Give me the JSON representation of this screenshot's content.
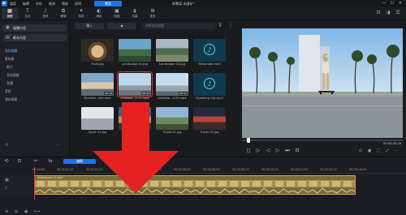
{
  "app": {
    "logo_glyph": "▶",
    "menus": [
      "檔案",
      "編輯",
      "外掛",
      "檢視",
      "播放",
      "說明"
    ],
    "project_button": "專案",
    "project_name": "新專案.未儲存*",
    "window_controls": [
      "—",
      "☐",
      "✕"
    ]
  },
  "toolbar": {
    "tools": [
      {
        "icon": "▦",
        "label": "媒體"
      },
      {
        "icon": "T",
        "label": "文字"
      },
      {
        "icon": "♪",
        "label": "音訊"
      },
      {
        "icon": "⧉",
        "label": "轉場"
      },
      {
        "icon": "✦",
        "label": "特效"
      },
      {
        "icon": "◐",
        "label": "調色"
      },
      {
        "icon": "▣",
        "label": "貼圖"
      },
      {
        "icon": "⧗",
        "label": "字幕"
      },
      {
        "icon": "⊞",
        "label": "更多"
      }
    ],
    "right_icons": [
      "⊡",
      "◑",
      "☰"
    ]
  },
  "sidebar": {
    "tabs": [
      "媒體內容",
      "範本內容"
    ],
    "items": [
      {
        "label": "我的媒體",
        "selected": true
      },
      {
        "label": "素材庫",
        "selected": false
      },
      {
        "label": "· 影片",
        "selected": false
      },
      {
        "label": "· 色彩圖樣",
        "selected": false
      },
      {
        "label": "· 背景",
        "selected": false
      },
      {
        "label": "音訊",
        "selected": false
      },
      {
        "label": "我的專案",
        "selected": false
      }
    ],
    "footer_icons": [
      "⟲",
      "⋯"
    ]
  },
  "media": {
    "import_button": "匯入",
    "view_button": "◉",
    "search_placeholder": "搜尋我的媒體",
    "items": [
      {
        "name": "Food.jpg",
        "duration": "",
        "kind": "food"
      },
      {
        "name": "Landscape 01.jpg",
        "duration": "",
        "kind": "landscape1"
      },
      {
        "name": "Landscape 02.jpg",
        "duration": "",
        "kind": "landscape2"
      },
      {
        "name": "Mahoroba.mp3",
        "duration": "",
        "kind": "music"
      },
      {
        "name": "Mountai...iker.mp4",
        "duration": "00:10",
        "kind": "mountain"
      },
      {
        "name": "Skatebo...d 01.mp4",
        "duration": "00:15",
        "kind": "skate1"
      },
      {
        "name": "Skatebo...d 02.mp4",
        "duration": "00:11",
        "kind": "skate2"
      },
      {
        "name": "Speaking Out.mp3",
        "duration": "",
        "kind": "music"
      },
      {
        "name": "Sport 01.jpg",
        "duration": "",
        "kind": "sport"
      },
      {
        "name": "Sport 02.jpg",
        "duration": "",
        "kind": "sport2"
      },
      {
        "name": "Travel 01.jpg",
        "duration": "",
        "kind": "travel1"
      },
      {
        "name": "Travel 02.jpg",
        "duration": "",
        "kind": "travel2"
      }
    ],
    "selected_index": 5
  },
  "preview": {
    "timecode": "00;00;00;00",
    "progress": 0.03,
    "controls": [
      "◻",
      "▷",
      "◁",
      "▷",
      "⏭",
      "⊡"
    ],
    "right_controls": [
      "⊙",
      "▣",
      "⛶",
      "⤢",
      "⋯"
    ]
  },
  "timeline": {
    "tools": [
      "⟲",
      "⊡",
      "✂",
      "⇆"
    ],
    "edit_tab": "編輯",
    "storyboard_tab": "腳本模式",
    "ruler": [
      "00;00;00",
      "00;00;01;10",
      "00;00;02;20",
      "00;00;04;00",
      "00;00;05;10",
      "00;00;06;20",
      "00;00;08;00",
      "00;00;09;10",
      "00;00;10;20",
      "00;00;12;00",
      "00;00;13;10",
      "00;00;14;20"
    ],
    "clip_label": "Skateboard 01.mp4",
    "track_icons": [
      "▣",
      "♪"
    ],
    "bottom_icons": [
      "⊕",
      "⊖",
      "◉",
      "⟷"
    ]
  }
}
